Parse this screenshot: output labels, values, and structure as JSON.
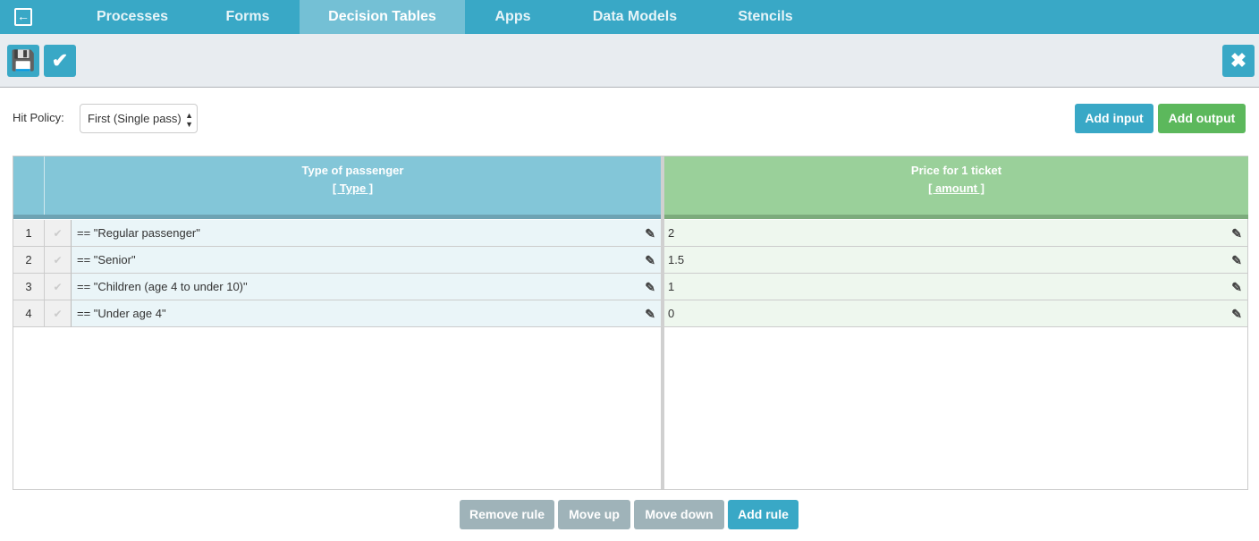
{
  "nav": {
    "tabs": [
      {
        "label": "Processes"
      },
      {
        "label": "Forms"
      },
      {
        "label": "Decision Tables",
        "active": true
      },
      {
        "label": "Apps"
      },
      {
        "label": "Data Models"
      },
      {
        "label": "Stencils"
      }
    ],
    "accent": "#39a8c6"
  },
  "toolbar": {
    "save_icon": "floppy-disk-icon",
    "validate_icon": "checkmark-icon",
    "close_icon": "close-x-icon"
  },
  "hit_policy": {
    "label": "Hit Policy:",
    "value": "First (Single pass)"
  },
  "actions": {
    "add_input": "Add input",
    "add_output": "Add output"
  },
  "table": {
    "input": {
      "title": "Type of passenger",
      "variable": "[ Type ]"
    },
    "output": {
      "title": "Price for 1 ticket",
      "variable": "[ amount ]"
    },
    "rows": [
      {
        "num": "1",
        "input": "== \"Regular passenger\"",
        "output": "2"
      },
      {
        "num": "2",
        "input": "== \"Senior\"",
        "output": "1.5"
      },
      {
        "num": "3",
        "input": "== \"Children (age 4 to under 10)\"",
        "output": "1"
      },
      {
        "num": "4",
        "input": "== \"Under age 4\"",
        "output": "0"
      }
    ]
  },
  "footer": {
    "remove_rule": "Remove rule",
    "move_up": "Move up",
    "move_down": "Move down",
    "add_rule": "Add rule"
  }
}
